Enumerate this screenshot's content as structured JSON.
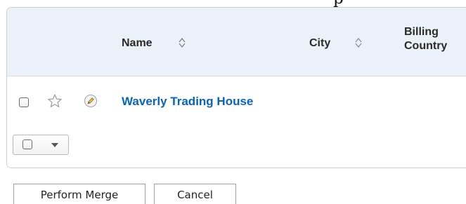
{
  "top_fragment": "p",
  "table": {
    "columns": [
      {
        "label": "Name",
        "sortable": true
      },
      {
        "label": "City",
        "sortable": true
      },
      {
        "label": "Billing Country",
        "sortable": false
      }
    ],
    "column_labels": {
      "name": "Name",
      "city": "City",
      "billing_line1": "Billing",
      "billing_line2": "Country"
    },
    "rows": [
      {
        "name": "Waverly Trading House",
        "city": "",
        "billing_country": ""
      }
    ]
  },
  "icons": {
    "sort": "sort-arrows-icon",
    "favorite": "star-icon",
    "edit": "pencil-icon",
    "dropdown": "caret-down-icon"
  },
  "colors": {
    "header_bg": "#eaf1f8",
    "link": "#0b63b6"
  },
  "buttons": {
    "merge": "Perform Merge",
    "cancel": "Cancel"
  }
}
